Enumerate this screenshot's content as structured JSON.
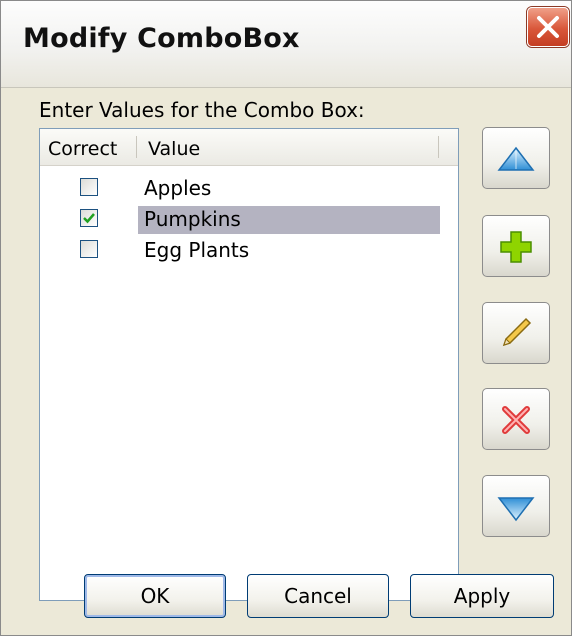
{
  "window": {
    "title": "Modify ComboBox"
  },
  "prompt": "Enter Values for the Combo Box:",
  "list": {
    "columns": [
      "Correct",
      "Value"
    ],
    "rows": [
      {
        "correct": false,
        "value": "Apples",
        "selected": false
      },
      {
        "correct": true,
        "value": "Pumpkins",
        "selected": true
      },
      {
        "correct": false,
        "value": "Egg Plants",
        "selected": false
      }
    ]
  },
  "side_buttons": [
    "move-up-icon",
    "add-icon",
    "edit-pencil-icon",
    "delete-icon",
    "move-down-icon"
  ],
  "buttons": {
    "ok": "OK",
    "cancel": "Cancel",
    "apply": "Apply"
  },
  "colors": {
    "selection": "#b4b3c1",
    "check": "#21a121",
    "add": "#8fd400",
    "delete": "#e03b3b"
  }
}
